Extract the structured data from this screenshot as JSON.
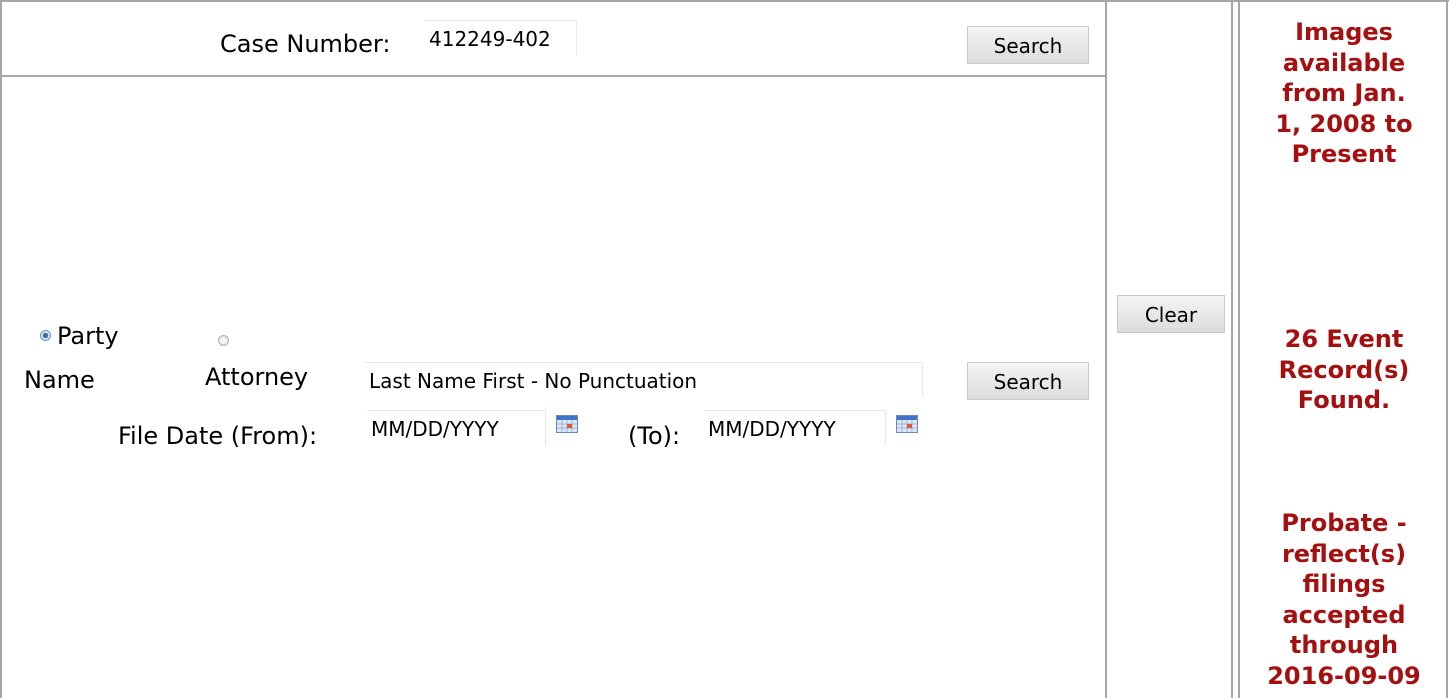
{
  "case_search": {
    "label": "Case Number:",
    "value": "412249-402",
    "search_label": "Search"
  },
  "name_search": {
    "radio_party_label_line1": "Party",
    "radio_party_label_line2": "Name",
    "radio_party_selected": true,
    "radio_attorney_label": "Attorney",
    "radio_attorney_selected": false,
    "name_placeholder": "Last Name First - No Punctuation",
    "search_label": "Search",
    "file_date_from_label": "File Date (From):",
    "file_date_from_placeholder": "MM/DD/YYYY",
    "file_date_to_label": "(To):",
    "file_date_to_placeholder": "MM/DD/YYYY",
    "calendar_icon": "calendar-icon"
  },
  "clear_label": "Clear",
  "side_panel": {
    "images_info": [
      "Images",
      "available",
      "from Jan.",
      "1, 2008 to",
      "Present"
    ],
    "record_count": [
      "26 Event",
      "Record(s)",
      "Found."
    ],
    "probate_note": [
      "Probate -",
      "reflect(s)",
      "filings",
      "accepted",
      "through",
      "2016-09-09"
    ],
    "text_color": "#a50f0f"
  },
  "colors": {
    "border": "#a6a6a6",
    "button_bg": "#e6e6e6"
  }
}
